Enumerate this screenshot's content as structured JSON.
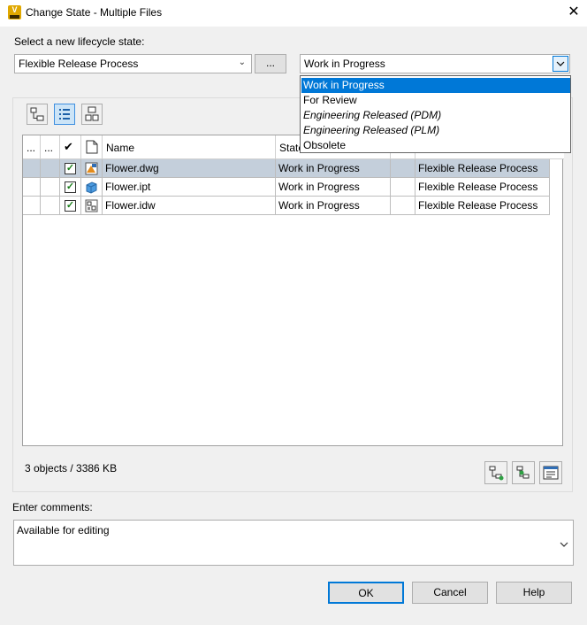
{
  "window": {
    "title": "Change State - Multiple Files",
    "close_glyph": "✕"
  },
  "lifecycle": {
    "label": "Select a new lifecycle state:",
    "process_value": "Flexible Release Process",
    "browse_label": "...",
    "state_value": "Work in Progress",
    "state_options": [
      {
        "label": "Work in Progress",
        "selected": true,
        "italic": false
      },
      {
        "label": "For Review",
        "selected": false,
        "italic": false
      },
      {
        "label": "Engineering Released (PDM)",
        "selected": false,
        "italic": true
      },
      {
        "label": "Engineering Released (PLM)",
        "selected": false,
        "italic": true
      },
      {
        "label": "Obsolete",
        "selected": false,
        "italic": false
      }
    ]
  },
  "grid": {
    "columns": {
      "c1": "...",
      "c2": "...",
      "check": "✔",
      "name": "Name",
      "state": "State",
      "process": ""
    },
    "rows": [
      {
        "name": "Flower.dwg",
        "state": "Work in Progress",
        "process": "Flexible Release Process",
        "checked": true,
        "icon": "dwg-file-icon"
      },
      {
        "name": "Flower.ipt",
        "state": "Work in Progress",
        "process": "Flexible Release Process",
        "checked": true,
        "icon": "ipt-file-icon"
      },
      {
        "name": "Flower.idw",
        "state": "Work in Progress",
        "process": "Flexible Release Process",
        "checked": true,
        "icon": "idw-file-icon"
      }
    ],
    "summary": "3 objects / 3386 KB"
  },
  "comments": {
    "label": "Enter comments:",
    "value": "Available for editing"
  },
  "buttons": {
    "ok": "OK",
    "cancel": "Cancel",
    "help": "Help"
  },
  "colors": {
    "accent": "#0078d7",
    "selected_row": "#c4cfdb",
    "check": "#1a7f1a"
  }
}
